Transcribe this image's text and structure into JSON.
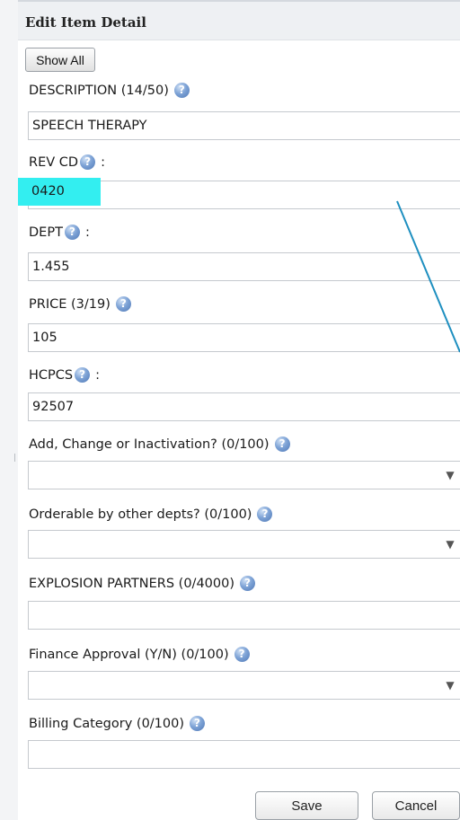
{
  "header": {
    "title": "Edit Item Detail"
  },
  "toolbar": {
    "show_all_label": "Show All"
  },
  "fields": {
    "description": {
      "label": "DESCRIPTION (14/50)",
      "value": "SPEECH THERAPY"
    },
    "rev_cd": {
      "label": "REV CD",
      "colon": ":",
      "value": "0420"
    },
    "dept": {
      "label": "DEPT",
      "colon": ":",
      "value": "1.455"
    },
    "price": {
      "label": "PRICE (3/19)",
      "value": "105"
    },
    "hcpcs": {
      "label": "HCPCS",
      "colon": ":",
      "value": "92507"
    },
    "add_change": {
      "label": "Add, Change or Inactivation? (0/100)",
      "value": ""
    },
    "orderable": {
      "label": "Orderable by other depts? (0/100)",
      "value": ""
    },
    "explosion": {
      "label": "EXPLOSION PARTNERS (0/4000)",
      "value": ""
    },
    "finance": {
      "label": "Finance Approval (Y/N) (0/100)",
      "value": ""
    },
    "billing": {
      "label": "Billing Category (0/100)",
      "value": ""
    }
  },
  "icons": {
    "help": "help-question-icon",
    "dropdown": "chevron-down-icon"
  },
  "actions": {
    "save_label": "Save",
    "cancel_label": "Cancel"
  },
  "colors": {
    "highlight": "#33eef0",
    "annotation_arrow": "#1e8fc0"
  }
}
